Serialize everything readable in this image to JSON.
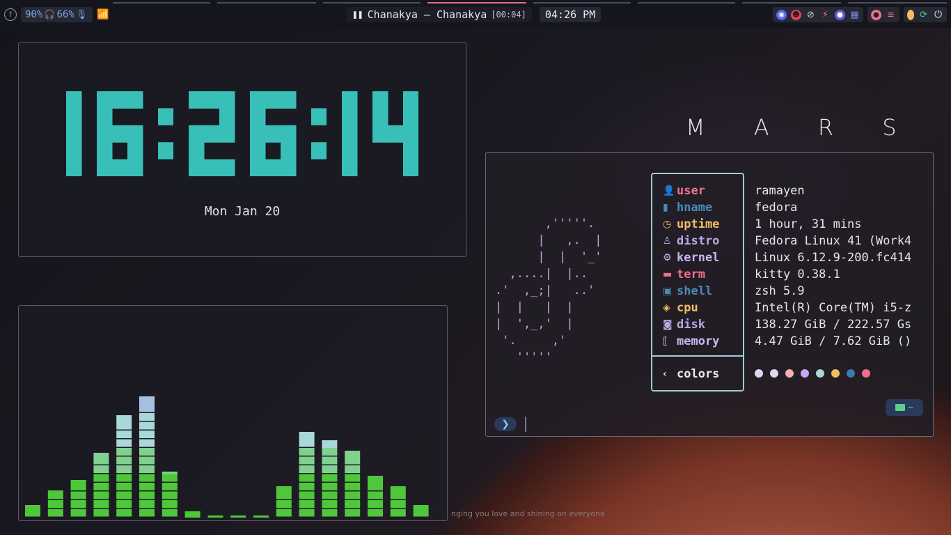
{
  "topbar": {
    "battery": "90%",
    "headphones": "66%",
    "media_title": "Chanakya – Chanakya",
    "media_time": "[00:04]",
    "clock": "04:26 PM",
    "tray_icons": [
      "discord-icon",
      "avatar-icon",
      "eye-off-icon",
      "bolt-icon",
      "vpn-icon",
      "chip-icon",
      "record-icon",
      "notes-icon",
      "moon-icon",
      "sync-icon",
      "power-icon"
    ]
  },
  "clock_widget": {
    "time": "16:26:14",
    "date": "Mon Jan 20"
  },
  "visualizer": {
    "bars": [
      0.06,
      0.13,
      0.18,
      0.31,
      0.49,
      0.58,
      0.22,
      0.03,
      0.01,
      0.01,
      0.01,
      0.15,
      0.41,
      0.37,
      0.32,
      0.2,
      0.15,
      0.06
    ],
    "ticker": "nging you love and shining on everyone"
  },
  "wallpaper": {
    "title": "M A R S"
  },
  "terminal": {
    "logo": [
      "       ,'''''.",
      "      |   ,.  |",
      "      |  |  '_'",
      "  ,....|  |..",
      ".'  ,_;|   ..'",
      "|  |   |  |",
      "|  ',_,'  |",
      " '.     ,'",
      "   '''''"
    ],
    "fields": [
      {
        "label": "user",
        "value": "ramayen",
        "icon": "👤",
        "color": "#f07090"
      },
      {
        "label": "hname",
        "value": "fedora",
        "icon": "▮",
        "color": "#4c8ab8"
      },
      {
        "label": "uptime",
        "value": "1 hour, 31 mins",
        "icon": "◷",
        "color": "#f0c060"
      },
      {
        "label": "distro",
        "value": "Fedora Linux 41 (Work4",
        "icon": "♙",
        "color": "#b8a8e0"
      },
      {
        "label": "kernel",
        "value": "Linux 6.12.9-200.fc414",
        "icon": "⚙",
        "color": "#c8b8f0"
      },
      {
        "label": "term",
        "value": "kitty 0.38.1",
        "icon": "▬",
        "color": "#f07090"
      },
      {
        "label": "shell",
        "value": "zsh 5.9",
        "icon": "▣",
        "color": "#4c8ab8"
      },
      {
        "label": "cpu",
        "value": "Intel(R) Core(TM) i5-z",
        "icon": "◈",
        "color": "#f0c060"
      },
      {
        "label": "disk",
        "value": "138.27 GiB / 222.57 Gs",
        "icon": "◙",
        "color": "#b8a8e0"
      },
      {
        "label": "memory",
        "value": "4.47 GiB / 7.62 GiB ()",
        "icon": "⟦",
        "color": "#c8b8f0"
      }
    ],
    "colors_label": "colors",
    "color_dots": [
      "#dcd8f0",
      "#dcd8f0",
      "#f0b0b0",
      "#c8a8f0",
      "#a8d8d8",
      "#f0c060",
      "#3a7ab0",
      "#f07090"
    ],
    "prompt_symbol": "❯",
    "dir_label": "~"
  }
}
